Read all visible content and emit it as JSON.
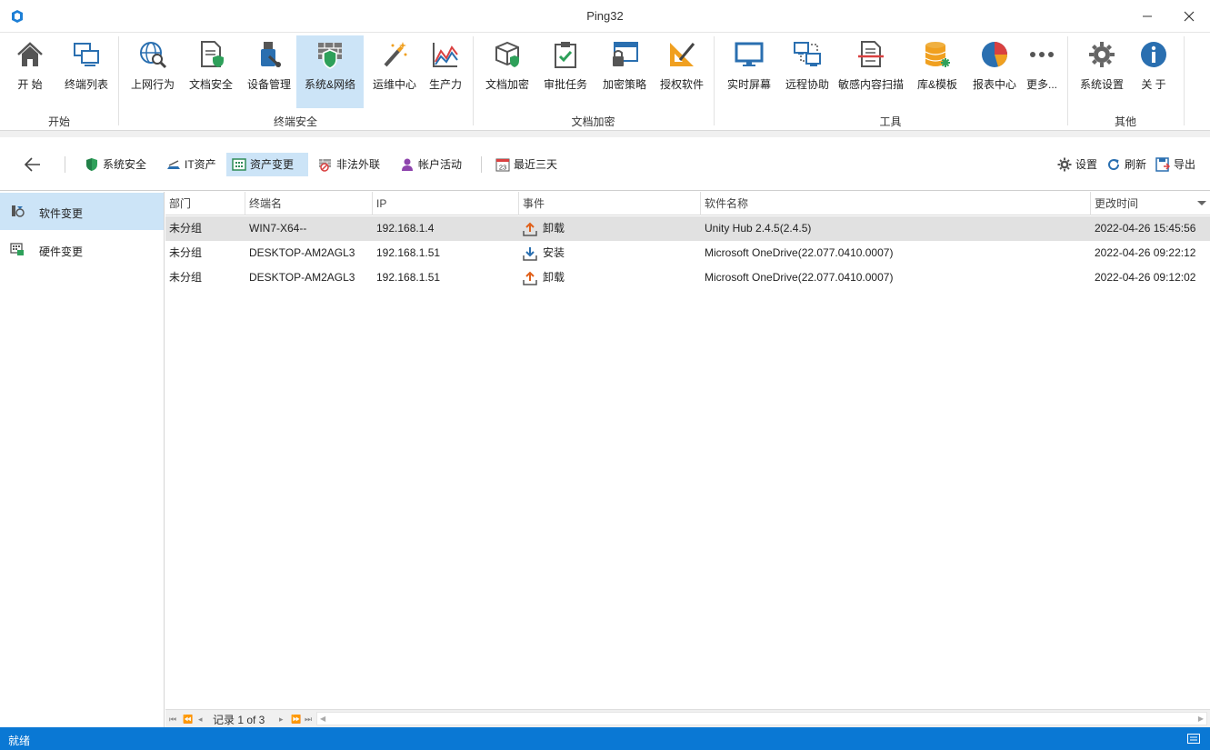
{
  "window": {
    "title": "Ping32"
  },
  "ribbon": {
    "groups": [
      {
        "label": "开始"
      },
      {
        "label": "终端安全"
      },
      {
        "label": "文档加密"
      },
      {
        "label": "工具"
      },
      {
        "label": "其他"
      }
    ],
    "buttons": [
      {
        "label": "开 始",
        "icon": "home-icon"
      },
      {
        "label": "终端列表",
        "icon": "terminal-list-icon"
      },
      {
        "label": "上网行为",
        "icon": "web-behavior-icon"
      },
      {
        "label": "文档安全",
        "icon": "document-security-icon"
      },
      {
        "label": "设备管理",
        "icon": "device-management-icon"
      },
      {
        "label": "系统&网络",
        "icon": "firewall-icon"
      },
      {
        "label": "运维中心",
        "icon": "magic-wand-icon"
      },
      {
        "label": "生产力",
        "icon": "productivity-chart-icon"
      },
      {
        "label": "文档加密",
        "icon": "encrypted-box-icon"
      },
      {
        "label": "审批任务",
        "icon": "clipboard-check-icon"
      },
      {
        "label": "加密策略",
        "icon": "lock-window-icon"
      },
      {
        "label": "授权软件",
        "icon": "authorize-software-icon"
      },
      {
        "label": "实时屏幕",
        "icon": "monitor-icon"
      },
      {
        "label": "远程协助",
        "icon": "remote-assist-icon"
      },
      {
        "label": "敏感内容扫描",
        "icon": "sensitive-scan-icon"
      },
      {
        "label": "库&模板",
        "icon": "database-icon"
      },
      {
        "label": "报表中心",
        "icon": "pie-chart-icon"
      },
      {
        "label": "更多...",
        "icon": "more-dots-icon"
      },
      {
        "label": "系统设置",
        "icon": "gear-icon"
      },
      {
        "label": "关 于",
        "icon": "info-icon"
      }
    ]
  },
  "toolbar": {
    "items": [
      {
        "label": "系统安全",
        "icon": "shield-icon"
      },
      {
        "label": "IT资产",
        "icon": "it-asset-icon"
      },
      {
        "label": "资产变更",
        "icon": "asset-change-icon"
      },
      {
        "label": "非法外联",
        "icon": "illegal-connection-icon"
      },
      {
        "label": "帐户活动",
        "icon": "account-activity-icon"
      },
      {
        "label": "最近三天",
        "icon": "calendar-icon"
      }
    ],
    "calendar_day": "23",
    "right": [
      {
        "label": "设置",
        "icon": "gear-icon"
      },
      {
        "label": "刷新",
        "icon": "refresh-icon"
      },
      {
        "label": "导出",
        "icon": "export-icon"
      }
    ]
  },
  "leftnav": {
    "items": [
      {
        "label": "软件变更",
        "icon": "software-change-icon"
      },
      {
        "label": "硬件变更",
        "icon": "hardware-change-icon"
      }
    ]
  },
  "grid": {
    "columns": [
      "部门",
      "终端名",
      "IP",
      "事件",
      "软件名称",
      "更改时间"
    ],
    "rows": [
      {
        "dept": "未分组",
        "terminal": "WIN7-X64--",
        "ip": "192.168.1.4",
        "event": "卸载",
        "event_icon": "uninstall-icon",
        "software": "Unity Hub 2.4.5(2.4.5)",
        "time": "2022-04-26 15:45:56"
      },
      {
        "dept": "未分组",
        "terminal": "DESKTOP-AM2AGL3",
        "ip": "192.168.1.51",
        "event": "安装",
        "event_icon": "install-icon",
        "software": "Microsoft OneDrive(22.077.0410.0007)",
        "time": "2022-04-26 09:22:12"
      },
      {
        "dept": "未分组",
        "terminal": "DESKTOP-AM2AGL3",
        "ip": "192.168.1.51",
        "event": "卸载",
        "event_icon": "uninstall-icon",
        "software": "Microsoft OneDrive(22.077.0410.0007)",
        "time": "2022-04-26 09:12:02"
      }
    ]
  },
  "pager": {
    "text": "记录 1 of 3"
  },
  "status": {
    "text": "就绪"
  },
  "colors": {
    "accent": "#0a78d4",
    "selected": "#cce4f7",
    "row_selected": "#e1e1e1"
  }
}
